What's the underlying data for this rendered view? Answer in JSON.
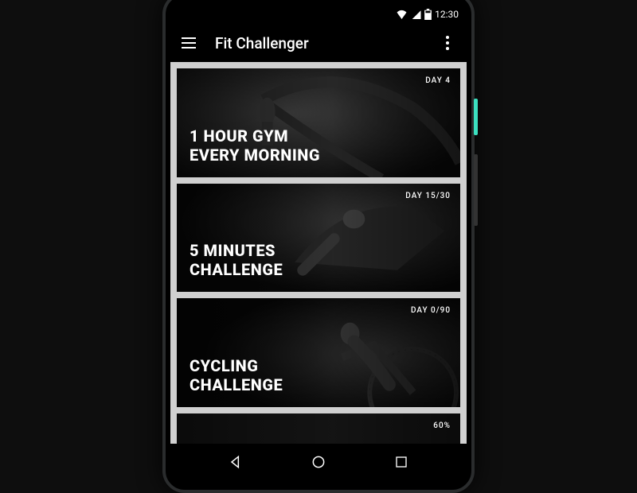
{
  "statusbar": {
    "time": "12:30"
  },
  "appbar": {
    "title": "Fit Challenger"
  },
  "cards": [
    {
      "title": "1 HOUR GYM\nEVERY MORNING",
      "badge": "DAY 4"
    },
    {
      "title": "5 MINUTES\nCHALLENGE",
      "badge": "DAY 15/30"
    },
    {
      "title": "CYCLING\nCHALLENGE",
      "badge": "DAY 0/90"
    },
    {
      "title": "",
      "badge": "60%"
    }
  ]
}
